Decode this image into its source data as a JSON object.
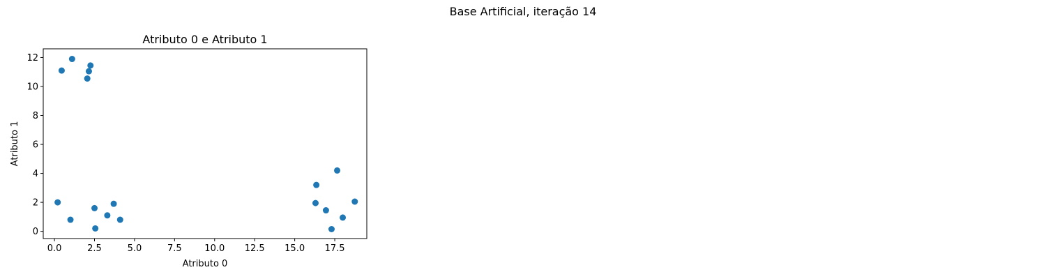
{
  "figure": {
    "suptitle": "Base Artificial, iteração 14"
  },
  "chart_data": {
    "type": "scatter",
    "title": "Atributo 0 e Atributo 1",
    "xlabel": "Atributo 0",
    "ylabel": "Atributo 1",
    "xlim": [
      -0.7,
      19.5
    ],
    "ylim": [
      -0.5,
      12.6
    ],
    "xticks": [
      0,
      2.5,
      5,
      7.5,
      10,
      12.5,
      15,
      17.5
    ],
    "xtick_labels": [
      "0.0",
      "2.5",
      "5.0",
      "7.5",
      "10.0",
      "12.5",
      "15.0",
      "17.5"
    ],
    "yticks": [
      0,
      2,
      4,
      6,
      8,
      10,
      12
    ],
    "ytick_labels": [
      "0",
      "2",
      "4",
      "6",
      "8",
      "10",
      "12"
    ],
    "grid": false,
    "marker_color": "#1f77b4",
    "x": [
      0.45,
      1.1,
      2.25,
      2.15,
      2.05,
      0.2,
      1.0,
      2.5,
      2.55,
      3.3,
      3.7,
      4.1,
      16.35,
      17.65,
      16.3,
      16.95,
      17.3,
      18.0,
      18.75
    ],
    "y": [
      11.1,
      11.9,
      11.45,
      11.05,
      10.55,
      2.0,
      0.8,
      1.6,
      0.2,
      1.1,
      1.9,
      0.8,
      3.2,
      4.2,
      1.95,
      1.45,
      0.15,
      0.95,
      2.05
    ]
  }
}
